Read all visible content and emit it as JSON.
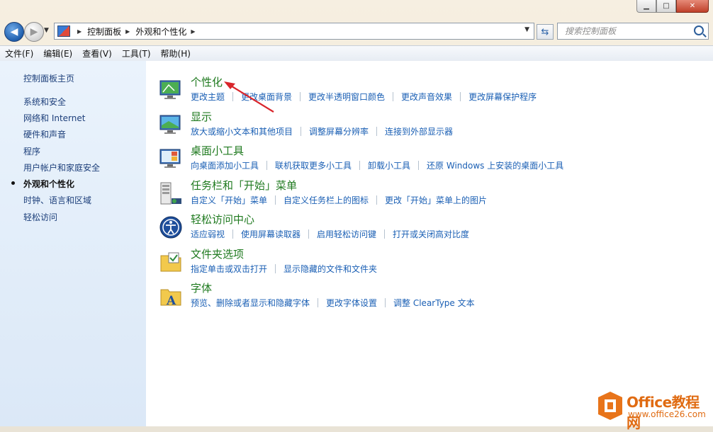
{
  "window": {
    "minimize": "▁",
    "maximize": "□",
    "close": "✕"
  },
  "navbar": {
    "breadcrumb": [
      "控制面板",
      "外观和个性化"
    ],
    "search_placeholder": "搜索控制面板"
  },
  "menu": [
    "文件(F)",
    "编辑(E)",
    "查看(V)",
    "工具(T)",
    "帮助(H)"
  ],
  "sidebar": {
    "items": [
      {
        "label": "控制面板主页",
        "active": false
      },
      {
        "label": "系统和安全",
        "active": false
      },
      {
        "label": "网络和 Internet",
        "active": false
      },
      {
        "label": "硬件和声音",
        "active": false
      },
      {
        "label": "程序",
        "active": false
      },
      {
        "label": "用户帐户和家庭安全",
        "active": false
      },
      {
        "label": "外观和个性化",
        "active": true
      },
      {
        "label": "时钟、语言和区域",
        "active": false
      },
      {
        "label": "轻松访问",
        "active": false
      }
    ]
  },
  "categories": [
    {
      "title": "个性化",
      "icon": "personalization-icon",
      "links": [
        "更改主题",
        "更改桌面背景",
        "更改半透明窗口颜色",
        "更改声音效果",
        "更改屏幕保护程序"
      ]
    },
    {
      "title": "显示",
      "icon": "display-icon",
      "links": [
        "放大或缩小文本和其他项目",
        "调整屏幕分辨率",
        "连接到外部显示器"
      ]
    },
    {
      "title": "桌面小工具",
      "icon": "gadgets-icon",
      "links": [
        "向桌面添加小工具",
        "联机获取更多小工具",
        "卸载小工具",
        "还原 Windows 上安装的桌面小工具"
      ]
    },
    {
      "title": "任务栏和「开始」菜单",
      "icon": "taskbar-icon",
      "links": [
        "自定义「开始」菜单",
        "自定义任务栏上的图标",
        "更改「开始」菜单上的图片"
      ]
    },
    {
      "title": "轻松访问中心",
      "icon": "ease-of-access-icon",
      "links": [
        "适应弱视",
        "使用屏幕读取器",
        "启用轻松访问键",
        "打开或关闭高对比度"
      ]
    },
    {
      "title": "文件夹选项",
      "icon": "folder-options-icon",
      "links": [
        "指定单击或双击打开",
        "显示隐藏的文件和文件夹"
      ]
    },
    {
      "title": "字体",
      "icon": "fonts-icon",
      "links": [
        "预览、删除或者显示和隐藏字体",
        "更改字体设置",
        "调整 ClearType 文本"
      ]
    }
  ],
  "watermark": {
    "line1": "Office教程网",
    "line2": "www.office26.com"
  },
  "colors": {
    "link": "#1a5fb4",
    "category_title": "#1f7a1f",
    "sidebar_link": "#1d3f7a",
    "annotation_arrow": "#d9252b",
    "watermark": "#e06b12"
  }
}
